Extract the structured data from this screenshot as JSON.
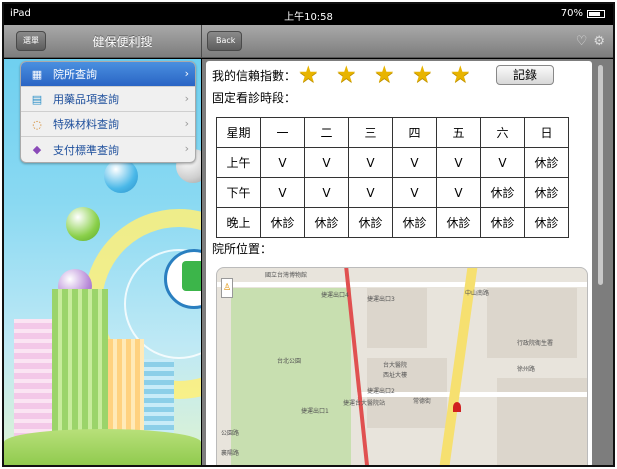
{
  "status": {
    "device": "iPad",
    "time": "上午10:58",
    "battery": "70%"
  },
  "nav_left": {
    "menu_label": "選單",
    "title": "健保便利搜"
  },
  "nav_right": {
    "back_label": "Back"
  },
  "menu": {
    "items": [
      {
        "label": "院所查詢",
        "icon": "building-icon",
        "active": true
      },
      {
        "label": "用藥品項查詢",
        "icon": "clipboard-icon",
        "active": false
      },
      {
        "label": "特殊材料查詢",
        "icon": "chat-bubble-icon",
        "active": false
      },
      {
        "label": "支付標準查詢",
        "icon": "hand-coin-icon",
        "active": false
      }
    ]
  },
  "detail": {
    "rating_label": "我的信賴指數：",
    "rating": 5,
    "record_label": "記錄",
    "fixed_hours_label": "固定看診時段：",
    "schedule": [
      [
        "星期",
        "一",
        "二",
        "三",
        "四",
        "五",
        "六",
        "日"
      ],
      [
        "上午",
        "V",
        "V",
        "V",
        "V",
        "V",
        "V",
        "休診"
      ],
      [
        "下午",
        "V",
        "V",
        "V",
        "V",
        "V",
        "休診",
        "休診"
      ],
      [
        "晚上",
        "休診",
        "休診",
        "休診",
        "休診",
        "休診",
        "休診",
        "休診"
      ]
    ],
    "location_label": "院所位置："
  },
  "map": {
    "labels": [
      "國立台灣博物館",
      "捷運出口4",
      "捷運出口3",
      "台北公園",
      "台大醫院",
      "西址大樓",
      "捷運出口2",
      "捷運台大醫院站",
      "捷運出口1",
      "中山南路",
      "常德街",
      "公園路",
      "襄陽路",
      "徐州路",
      "行政院衛生署"
    ]
  },
  "colors": {
    "accent": "#2a64c4",
    "star": "#e8b400"
  }
}
